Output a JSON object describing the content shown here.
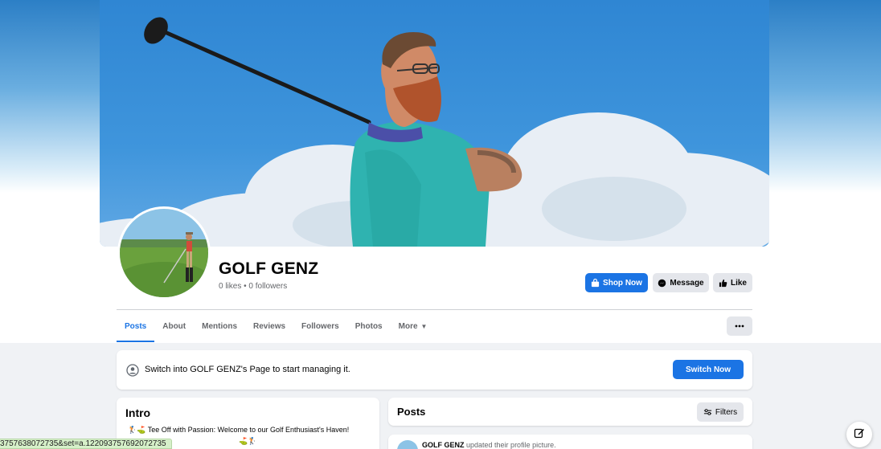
{
  "page": {
    "name": "GOLF GENZ",
    "stats": "0 likes • 0 followers"
  },
  "actions": {
    "shop_now": "Shop Now",
    "message": "Message",
    "like": "Like"
  },
  "tabs": [
    {
      "label": "Posts",
      "active": true
    },
    {
      "label": "About"
    },
    {
      "label": "Mentions"
    },
    {
      "label": "Reviews"
    },
    {
      "label": "Followers"
    },
    {
      "label": "Photos"
    },
    {
      "label": "More"
    }
  ],
  "switch_banner": {
    "text": "Switch into GOLF GENZ's Page to start managing it.",
    "button": "Switch Now"
  },
  "intro": {
    "title": "Intro",
    "bio": "🏌️⛳ Tee Off with Passion: Welcome to our Golf Enthusiast's Haven!",
    "bio_line2": "⛳🏌️"
  },
  "posts": {
    "title": "Posts",
    "filters": "Filters",
    "first_post_author": "GOLF GENZ",
    "first_post_text": "updated their profile picture."
  },
  "status_url": "3757638072735&set=a.122093757692072735",
  "colors": {
    "accent": "#1b74e4",
    "button_gray": "#e4e6eb",
    "page_bg": "#f0f2f5"
  },
  "icons": {
    "shop": "shop-bag-icon",
    "message": "messenger-icon",
    "like": "thumbs-up-icon",
    "more": "ellipsis-icon",
    "filters": "sliders-icon",
    "compose": "compose-icon"
  }
}
